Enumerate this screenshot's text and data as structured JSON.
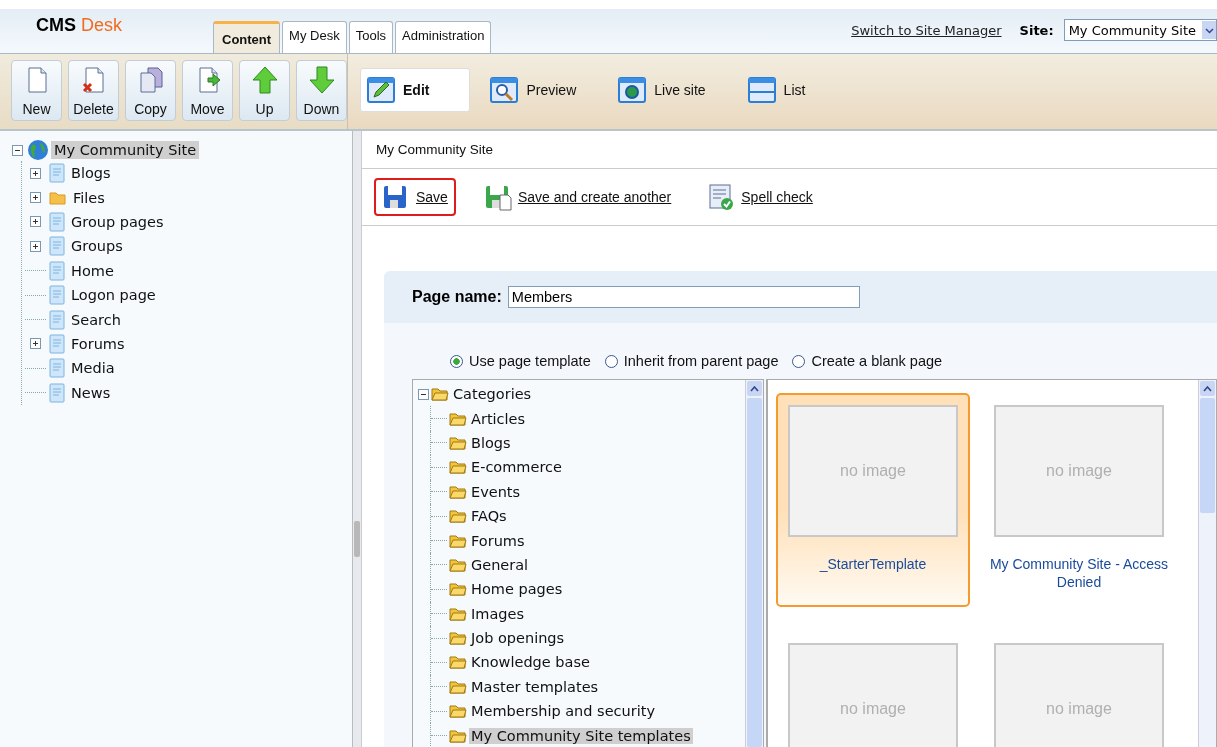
{
  "header": {
    "logo_main": "CMS",
    "logo_accent": "Desk",
    "tabs": [
      {
        "label": "Content",
        "selected": true
      },
      {
        "label": "My Desk",
        "selected": false
      },
      {
        "label": "Tools",
        "selected": false
      },
      {
        "label": "Administration",
        "selected": false
      }
    ],
    "switch_link": "Switch to Site Manager",
    "site_label": "Site:",
    "site_value": "My Community Site"
  },
  "toolbar": {
    "buttons": [
      {
        "label": "New",
        "kind": "new"
      },
      {
        "label": "Delete",
        "kind": "delete"
      },
      {
        "label": "Copy",
        "kind": "copy"
      },
      {
        "label": "Move",
        "kind": "move"
      },
      {
        "label": "Up",
        "kind": "up"
      },
      {
        "label": "Down",
        "kind": "down"
      }
    ],
    "views": [
      {
        "label": "Edit",
        "kind": "edit",
        "selected": true
      },
      {
        "label": "Preview",
        "kind": "preview",
        "selected": false
      },
      {
        "label": "Live site",
        "kind": "live",
        "selected": false
      },
      {
        "label": "List",
        "kind": "list",
        "selected": false
      }
    ]
  },
  "tree": {
    "label": "My Community Site",
    "expanded": true,
    "selected": true,
    "children": [
      {
        "label": "Blogs",
        "kind": "page",
        "has_children": true
      },
      {
        "label": "Files",
        "kind": "folder",
        "has_children": true
      },
      {
        "label": "Group pages",
        "kind": "page",
        "has_children": true
      },
      {
        "label": "Groups",
        "kind": "page",
        "has_children": true
      },
      {
        "label": "Home",
        "kind": "page",
        "has_children": false
      },
      {
        "label": "Logon page",
        "kind": "page",
        "has_children": false
      },
      {
        "label": "Search",
        "kind": "page",
        "has_children": false
      },
      {
        "label": "Forums",
        "kind": "page",
        "has_children": true
      },
      {
        "label": "Media",
        "kind": "page",
        "has_children": false
      },
      {
        "label": "News",
        "kind": "page",
        "has_children": false
      }
    ]
  },
  "breadcrumb": "My Community Site",
  "actions": [
    {
      "label": "Save",
      "kind": "save",
      "highlighted": true
    },
    {
      "label": "Save and create another",
      "kind": "save_another",
      "highlighted": false
    },
    {
      "label": "Spell check",
      "kind": "spell",
      "highlighted": false
    }
  ],
  "page_name": {
    "label": "Page name:",
    "value": "Members"
  },
  "options": [
    {
      "label": "Use page template",
      "selected": true
    },
    {
      "label": "Inherit from parent page",
      "selected": false
    },
    {
      "label": "Create a blank page",
      "selected": false
    }
  ],
  "categories": {
    "label": "Categories",
    "expanded": true,
    "children": [
      {
        "label": "Articles",
        "selected": false
      },
      {
        "label": "Blogs",
        "selected": false
      },
      {
        "label": "E-commerce",
        "selected": false
      },
      {
        "label": "Events",
        "selected": false
      },
      {
        "label": "FAQs",
        "selected": false
      },
      {
        "label": "Forums",
        "selected": false
      },
      {
        "label": "General",
        "selected": false
      },
      {
        "label": "Home pages",
        "selected": false
      },
      {
        "label": "Images",
        "selected": false
      },
      {
        "label": "Job openings",
        "selected": false
      },
      {
        "label": "Knowledge base",
        "selected": false
      },
      {
        "label": "Master templates",
        "selected": false
      },
      {
        "label": "Membership and security",
        "selected": false
      },
      {
        "label": "My Community Site templates",
        "selected": true
      }
    ]
  },
  "templates": [
    {
      "preview": "no image",
      "label": "_StarterTemplate",
      "selected": true
    },
    {
      "preview": "no image",
      "label": "My Community Site - Access Denied",
      "selected": false
    },
    {
      "preview": "no image",
      "selected": false
    },
    {
      "preview": "no image",
      "selected": false
    }
  ]
}
